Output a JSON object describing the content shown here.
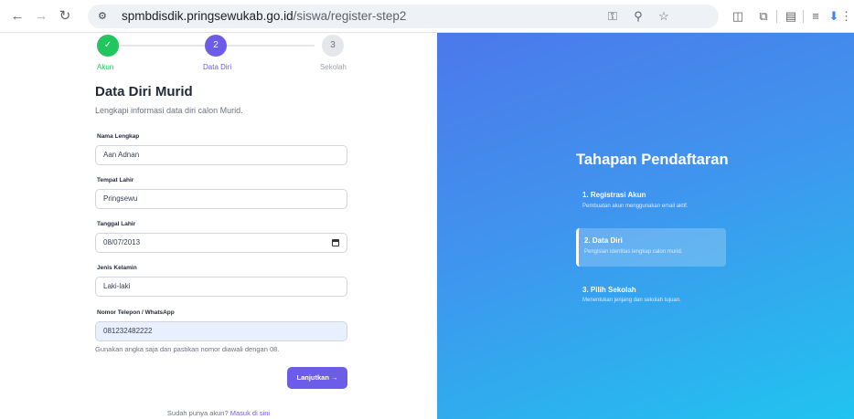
{
  "browser": {
    "url_host": "spmbdisdik.pringsewukab.go.id",
    "url_path": "/siswa/register-step2"
  },
  "steps": [
    {
      "symbol": "✓",
      "label": "Akun",
      "state": "done",
      "color": "#22c55e"
    },
    {
      "symbol": "2",
      "label": "Data Diri",
      "state": "active",
      "color": "#6d5ce7"
    },
    {
      "symbol": "3",
      "label": "Sekolah",
      "state": "pending",
      "color": "#e5e7eb"
    }
  ],
  "form": {
    "title": "Data Diri Murid",
    "subtitle": "Lengkapi informasi data diri calon Murid.",
    "fields": [
      {
        "label": "Nama Lengkap",
        "value": "Aan Adnan"
      },
      {
        "label": "Tempat Lahir",
        "value": "Pringsewu"
      },
      {
        "label": "Tanggal Lahir",
        "value": "08/07/2013"
      },
      {
        "label": "Jenis Kelamin",
        "value": "Laki-laki"
      },
      {
        "label": "Nomor Telepon / WhatsApp",
        "value": "081232482222"
      }
    ],
    "phone_hint": "Gunakan angka saja dan pastikan nomor diawali dengan 08.",
    "next_button": "Lanjutkan →",
    "login_prompt": "Sudah punya akun?",
    "login_link": "Masuk di sini"
  },
  "sidebar": {
    "title": "Tahapan Pendaftaran",
    "stages": [
      {
        "title": "1. Registrasi Akun",
        "desc": "Pembuatan akun menggunakan email aktif."
      },
      {
        "title": "2. Data Diri",
        "desc": "Pengisian identitas lengkap calon murid."
      },
      {
        "title": "3. Pilih Sekolah",
        "desc": "Menentukan jenjang dan sekolah tujuan."
      }
    ]
  },
  "colors": {
    "accent": "#6d5ce7",
    "success": "#22c55e",
    "gradient_start": "#4c78eb",
    "gradient_end": "#20c4ef"
  },
  "icons": [
    "back-arrow-icon",
    "forward-arrow-icon",
    "reload-icon",
    "site-info-icon",
    "password-key-icon",
    "zoom-icon",
    "star-icon",
    "screenshot-icon",
    "extensions-icon",
    "side-panel-icon",
    "reading-list-icon",
    "profile-icon",
    "menu-icon",
    "calendar-icon"
  ]
}
